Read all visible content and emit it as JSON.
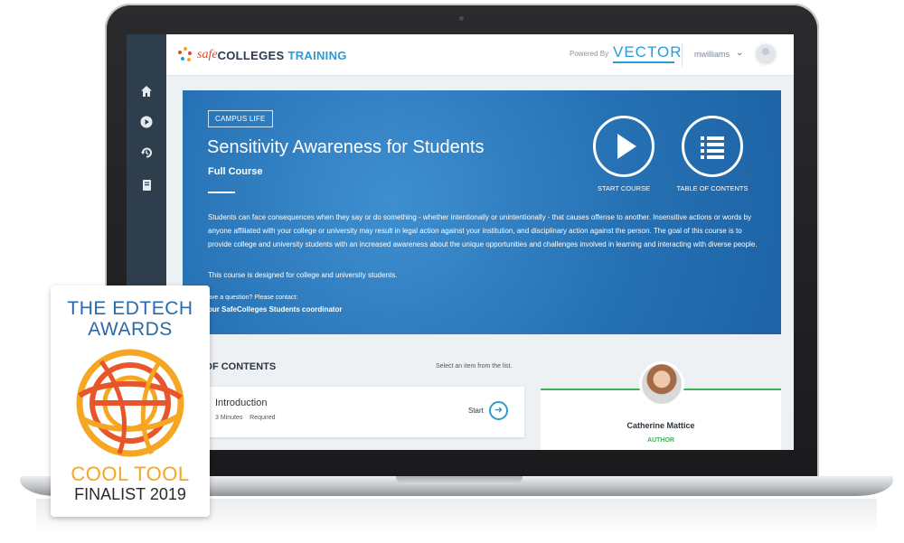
{
  "app": {
    "logo": {
      "safe": "safe",
      "colleges": "COLLEGES",
      "training": "TRAINING"
    },
    "powered_by": "Powered By",
    "vector_logo": "VECTOR",
    "username": "mwilliams",
    "user_menu_icon": "chevron-down-icon"
  },
  "sidebar": {
    "items": [
      {
        "icon": "home-icon"
      },
      {
        "icon": "play-circle-icon"
      },
      {
        "icon": "history-icon"
      },
      {
        "icon": "book-icon"
      }
    ]
  },
  "hero": {
    "category": "CAMPUS LIFE",
    "title": "Sensitivity Awareness for Students",
    "subtitle": "Full Course",
    "description": "Students can face consequences when they say or do something - whether intentionally or unintentionally - that causes offense to another. Insensitive actions or words by anyone affiliated with your college or university may result in legal action against your institution, and disciplinary action against the person. The goal of this course is to provide college and university students with an increased awareness about the unique opportunities and challenges involved in learning and interacting with diverse people.",
    "note": "This course is designed for college and university students.",
    "contact_prompt": "ave a question? Please contact:",
    "contact_name": "our SafeColleges Students coordinator",
    "start_course": "START COURSE",
    "table_of_contents": "TABLE OF CONTENTS",
    "colors": {
      "background": "#2672b5",
      "text": "#ffffff"
    }
  },
  "toc": {
    "heading": "E OF CONTENTS",
    "hint": "Select an item from the list.",
    "items": [
      {
        "title": "Introduction",
        "duration": "3 Minutes",
        "status": "Required",
        "action": "Start"
      }
    ]
  },
  "author": {
    "name": "Catherine Mattice",
    "role": "AUTHOR",
    "accent": "#3fb05a"
  },
  "award": {
    "line1": "THE EDTECH",
    "line2": "AWARDS",
    "cool_tool": "COOL TOOL",
    "finalist": "FINALIST 2019",
    "colors": {
      "blue": "#2b6aa8",
      "orange": "#f5a623",
      "deep_orange": "#e8552b"
    }
  }
}
